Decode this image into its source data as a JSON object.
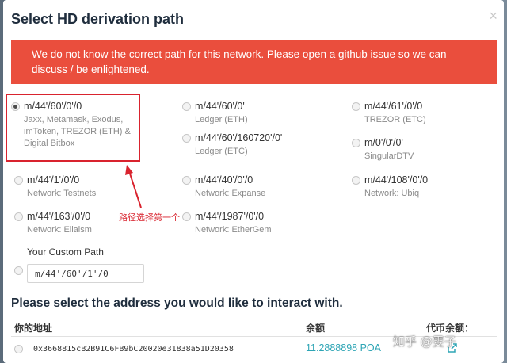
{
  "modal": {
    "title": "Select HD derivation path",
    "close_glyph": "×"
  },
  "alert": {
    "text_before": "We do not know the correct path for this network. ",
    "link": "Please open a github issue ",
    "text_after": "so we can discuss / be enlightened."
  },
  "paths": [
    {
      "path": "m/44'/60'/0'/0",
      "desc_lines": [
        "Jaxx, Metamask, Exodus,",
        "imToken, TREZOR (ETH) &",
        "Digital Bitbox"
      ],
      "selected": true
    },
    {
      "path": "m/44'/60'/0'",
      "desc_lines": [
        "Ledger (ETH)"
      ],
      "selected": false
    },
    {
      "path": "m/44'/61'/0'/0",
      "desc_lines": [
        "TREZOR (ETC)"
      ],
      "selected": false
    },
    {
      "path": "m/44'/60'/160720'/0'",
      "desc_lines": [
        "Ledger (ETC)"
      ],
      "selected": false
    },
    {
      "path": "m/0'/0'/0'",
      "desc_lines": [
        "SingularDTV"
      ],
      "selected": false
    },
    {
      "path": "m/44'/1'/0'/0",
      "desc_lines": [
        "Network: Testnets"
      ],
      "selected": false
    },
    {
      "path": "m/44'/40'/0'/0",
      "desc_lines": [
        "Network: Expanse"
      ],
      "selected": false
    },
    {
      "path": "m/44'/108'/0'/0",
      "desc_lines": [
        "Network: Ubiq"
      ],
      "selected": false
    },
    {
      "path": "m/44'/163'/0'/0",
      "desc_lines": [
        "Network: Ellaism"
      ],
      "selected": false
    },
    {
      "path": "m/44'/1987'/0'/0",
      "desc_lines": [
        "Network: EtherGem"
      ],
      "selected": false
    }
  ],
  "custom": {
    "label": "Your Custom Path",
    "value": "m/44'/60'/1'/0"
  },
  "annotation": "路径选择第一个",
  "address_section": {
    "title": "Please select the address you would like to interact with.",
    "headers": [
      "你的地址",
      "余额",
      "代币余额："
    ],
    "rows": [
      {
        "address": "0x3668815cB2B91C6FB9bC20020e31838a51D20358",
        "balance": "11.2888898 POA"
      }
    ]
  },
  "watermark": "知乎 @雯子",
  "colors": {
    "alert": "#ea4e3d",
    "annotation": "#d9232e",
    "balance": "#2ea5b5"
  },
  "icons": {
    "close": "close-icon",
    "external": "external-link-icon"
  }
}
